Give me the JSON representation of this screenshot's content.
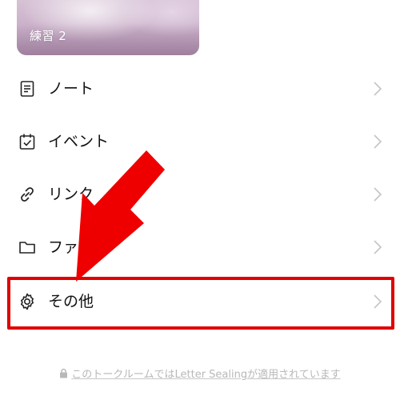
{
  "album": {
    "label": "練習 2"
  },
  "menu": [
    {
      "key": "note",
      "label": "ノート",
      "icon": "note-icon"
    },
    {
      "key": "event",
      "label": "イベント",
      "icon": "calendar-check-icon"
    },
    {
      "key": "link",
      "label": "リンク",
      "icon": "link-icon"
    },
    {
      "key": "file",
      "label": "ファ",
      "icon": "folder-icon"
    },
    {
      "key": "other",
      "label": "その他",
      "icon": "gear-icon"
    }
  ],
  "footer": {
    "text": "このトークルームではLetter Sealingが適用されています",
    "icon": "lock-icon"
  },
  "colors": {
    "annotation_red": "#e00000",
    "chevron": "#c4c4c4",
    "footer_text": "#b8b8b8"
  }
}
